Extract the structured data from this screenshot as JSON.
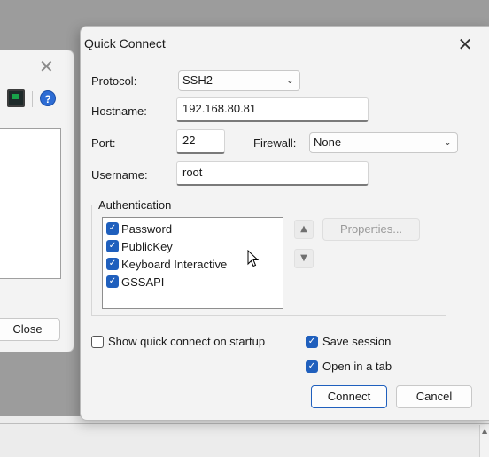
{
  "background_window": {
    "close_button_label": "Close"
  },
  "dialog": {
    "title": "Quick Connect",
    "protocol_label": "Protocol:",
    "protocol_value": "SSH2",
    "hostname_label": "Hostname:",
    "hostname_value": "192.168.80.81",
    "port_label": "Port:",
    "port_value": "22",
    "firewall_label": "Firewall:",
    "firewall_value": "None",
    "username_label": "Username:",
    "username_value": "root",
    "authentication": {
      "title": "Authentication",
      "methods": [
        {
          "label": "Password",
          "checked": true
        },
        {
          "label": "PublicKey",
          "checked": true
        },
        {
          "label": "Keyboard Interactive",
          "checked": true
        },
        {
          "label": "GSSAPI",
          "checked": true
        }
      ],
      "properties_label": "Properties..."
    },
    "show_quick_connect_label": "Show quick connect on startup",
    "show_quick_connect_checked": false,
    "save_session_label": "Save session",
    "save_session_checked": true,
    "open_in_tab_label": "Open in a tab",
    "open_in_tab_checked": true,
    "connect_label": "Connect",
    "cancel_label": "Cancel"
  },
  "colors": {
    "accent": "#1f5fbd",
    "dialog_bg": "#f3f3f3",
    "desktop_bg": "#9c9c9c"
  }
}
